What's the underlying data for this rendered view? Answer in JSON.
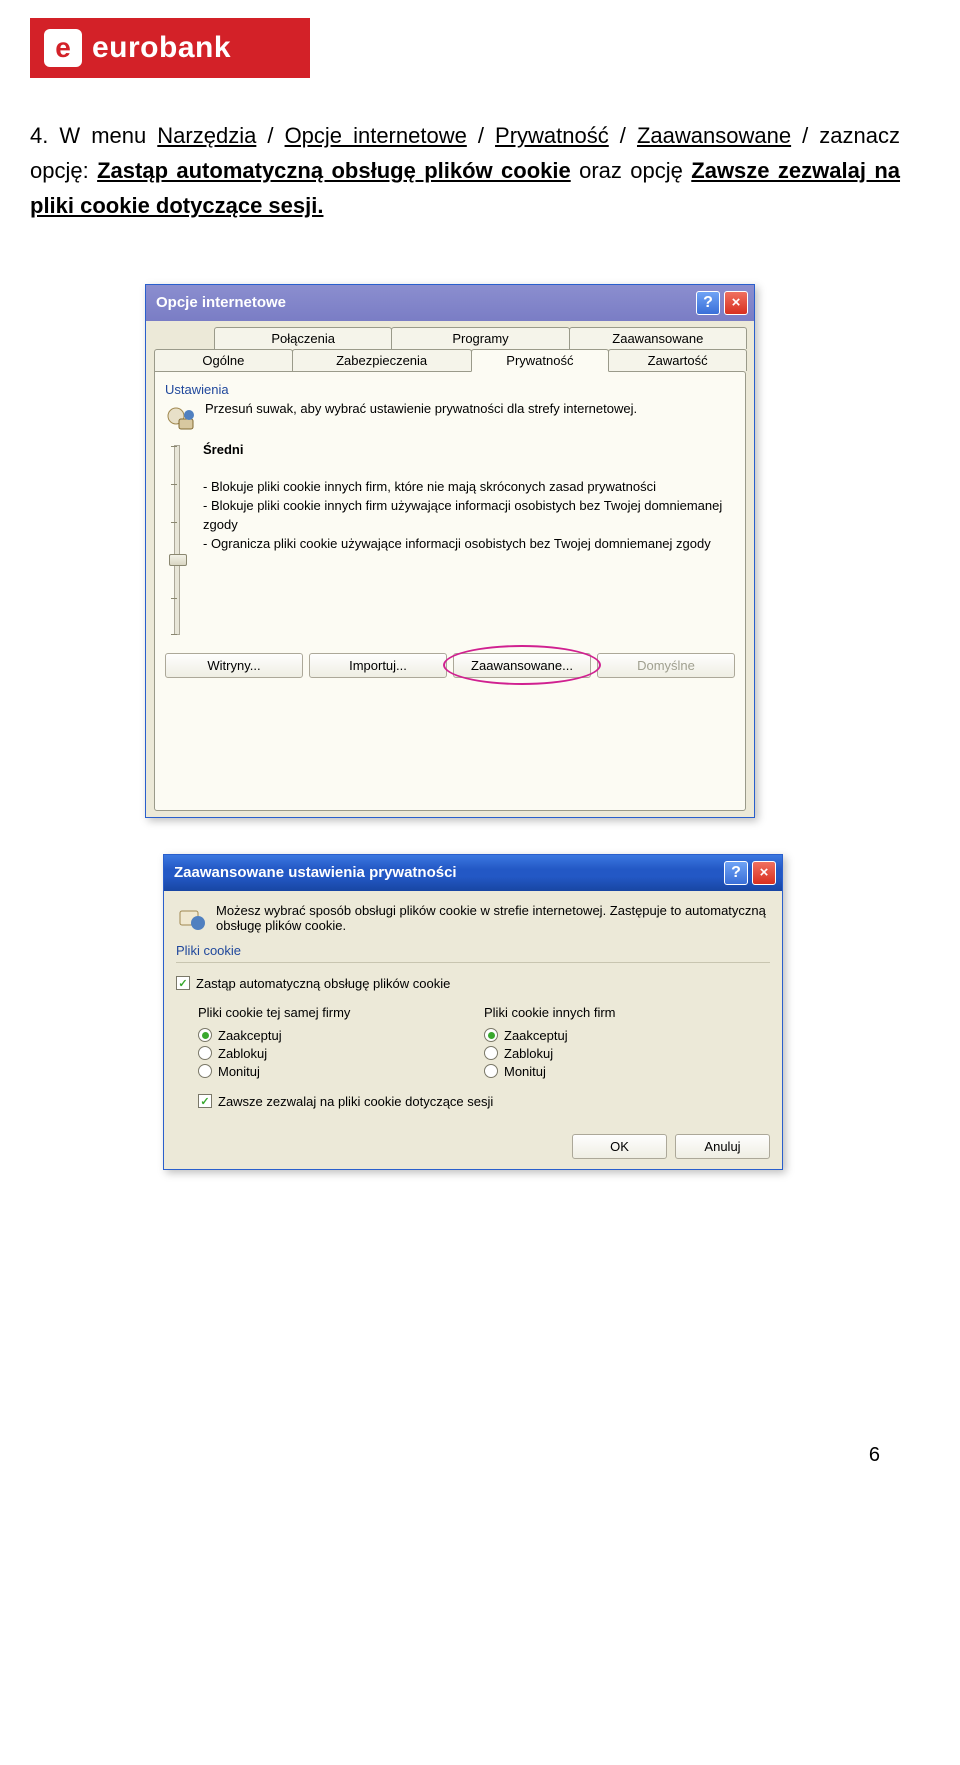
{
  "logo": {
    "initial": "e",
    "name": "eurobank"
  },
  "instruction": {
    "number": "4.",
    "text_prefix": "W menu ",
    "menu1": "Narzędzia",
    "sep": " / ",
    "menu2": "Opcje internetowe",
    "menu3": "Prywatność",
    "menu4": "Zaawansowane",
    "text_mid": " / zaznacz opcję: ",
    "opt1": "Zastąp automatyczną obsługę plików cookie",
    "text_mid2": " oraz opcję ",
    "opt2": "Zawsze zezwalaj na pliki cookie dotyczące sesji."
  },
  "dialog1": {
    "title": "Opcje internetowe",
    "tabs_top": [
      "Połączenia",
      "Programy",
      "Zaawansowane"
    ],
    "tabs_bottom": [
      "Ogólne",
      "Zabezpieczenia",
      "Prywatność",
      "Zawartość"
    ],
    "section": "Ustawienia",
    "desc": "Przesuń suwak, aby wybrać ustawienie prywatności dla strefy internetowej.",
    "level": "Średni",
    "bullets": "- Blokuje pliki cookie innych firm, które nie mają skróconych zasad prywatności\n- Blokuje pliki cookie innych firm używające informacji osobistych bez Twojej domniemanej zgody\n- Ogranicza pliki cookie używające informacji osobistych bez Twojej domniemanej zgody",
    "btn_sites": "Witryny...",
    "btn_import": "Importuj...",
    "btn_adv": "Zaawansowane...",
    "btn_default": "Domyślne"
  },
  "dialog2": {
    "title": "Zaawansowane ustawienia prywatności",
    "desc": "Możesz wybrać sposób obsługi plików cookie w strefie internetowej. Zastępuje to automatyczną obsługę plików cookie.",
    "group": "Pliki cookie",
    "chk_override": "Zastąp automatyczną obsługę plików cookie",
    "col1_title": "Pliki cookie tej samej firmy",
    "col2_title": "Pliki cookie innych firm",
    "opt_accept": "Zaakceptuj",
    "opt_block": "Zablokuj",
    "opt_prompt": "Monituj",
    "chk_session": "Zawsze zezwalaj na pliki cookie dotyczące sesji",
    "btn_ok": "OK",
    "btn_cancel": "Anuluj"
  },
  "page_number": "6"
}
